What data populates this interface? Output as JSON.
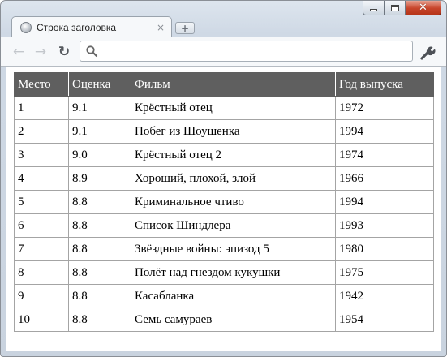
{
  "window": {
    "tab_title": "Строка заголовка",
    "tab_close_glyph": "×",
    "new_tab_glyph": "+",
    "icons": {
      "favicon": "globe-icon",
      "back": "back-arrow-icon",
      "forward": "forward-arrow-icon",
      "reload": "reload-icon",
      "search": "search-icon",
      "menu": "wrench-icon",
      "minimize": "minimize-icon",
      "maximize": "maximize-icon",
      "close": "close-icon"
    }
  },
  "toolbar": {
    "back_glyph": "←",
    "forward_glyph": "→",
    "reload_glyph": "↻",
    "address_value": "",
    "address_placeholder": ""
  },
  "table": {
    "headers": [
      "Место",
      "Оценка",
      "Фильм",
      "Год выпуска"
    ],
    "rows": [
      [
        "1",
        "9.1",
        "Крёстный отец",
        "1972"
      ],
      [
        "2",
        "9.1",
        "Побег из Шоушенка",
        "1994"
      ],
      [
        "3",
        "9.0",
        "Крёстный отец 2",
        "1974"
      ],
      [
        "4",
        "8.9",
        "Хороший, плохой, злой",
        "1966"
      ],
      [
        "5",
        "8.8",
        "Криминальное чтиво",
        "1994"
      ],
      [
        "6",
        "8.8",
        "Список Шиндлера",
        "1993"
      ],
      [
        "7",
        "8.8",
        "Звёздные войны: эпизод 5",
        "1980"
      ],
      [
        "8",
        "8.8",
        "Полёт над гнездом кукушки",
        "1975"
      ],
      [
        "9",
        "8.8",
        "Касабланка",
        "1942"
      ],
      [
        "10",
        "8.8",
        "Семь самураев",
        "1954"
      ]
    ]
  },
  "colors": {
    "header_bg": "#5f5f5f",
    "header_text": "#ffffff",
    "cell_border": "#a4a4a4",
    "close_button": "#c7442a"
  }
}
